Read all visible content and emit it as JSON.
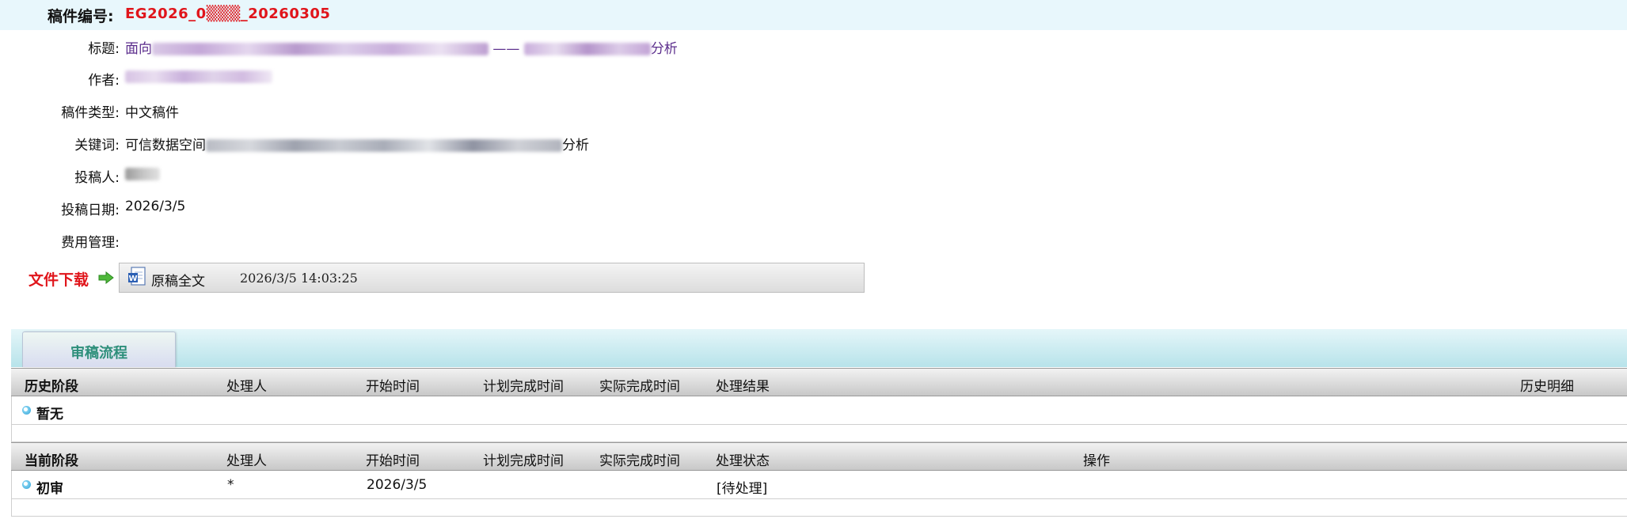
{
  "manuscript": {
    "id_label": "稿件编号:",
    "id_value": "EG2026_0▒▒▒_20260305"
  },
  "info": {
    "title_label": "标题:",
    "title_prefix": "面向",
    "title_mid": " —— ",
    "title_suffix": "分析",
    "author_label": "作者:",
    "type_label": "稿件类型:",
    "type_value": "中文稿件",
    "keywords_label": "关键词:",
    "keywords_prefix": "可信数据空间",
    "keywords_suffix": "分析",
    "submitter_label": "投稿人:",
    "date_label": "投稿日期:",
    "date_value": "2026/3/5",
    "fee_label": "费用管理:",
    "fee_value": ""
  },
  "download": {
    "label": "文件下载",
    "file_name": "原稿全文",
    "file_time": "2026/3/5 14:03:25",
    "icon": "word-doc-icon"
  },
  "workflow": {
    "tab_label": "审稿流程",
    "history_headers": [
      "历史阶段",
      "处理人",
      "开始时间",
      "计划完成时间",
      "实际完成时间",
      "处理结果",
      "历史明细"
    ],
    "history_empty": "暂无",
    "current_headers": [
      "当前阶段",
      "处理人",
      "开始时间",
      "计划完成时间",
      "实际完成时间",
      "处理状态",
      "操作"
    ],
    "current_rows": [
      {
        "stage": "初审",
        "handler": "*",
        "start": "2026/3/5",
        "planned": "",
        "actual": "",
        "status": "[待处理]",
        "action": ""
      }
    ]
  },
  "colors": {
    "accent_red": "#e0151b",
    "link_purple": "#5b2d8c",
    "tab_text": "#2e8f7b"
  }
}
